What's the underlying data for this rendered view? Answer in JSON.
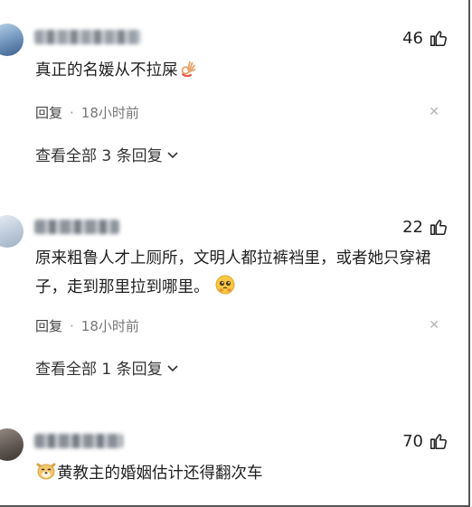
{
  "comments": [
    {
      "likes": "46",
      "text": "真正的名媛从不拉屎",
      "emoji_icon": "ok-hand-emoji-icon",
      "reply_label": "回复",
      "separator": "·",
      "time": "18小时前",
      "view_replies": "查看全部 3 条回复"
    },
    {
      "likes": "22",
      "text": "原来粗鲁人才上厕所，文明人都拉裤裆里，或者她只穿裙子，走到那里拉到哪里。",
      "emoji_icon": "pleading-face-emoji-icon",
      "reply_label": "回复",
      "separator": "·",
      "time": "18小时前",
      "view_replies": "查看全部 1 条回复"
    },
    {
      "likes": "70",
      "text": "黄教主的婚姻估计还得翻次车",
      "emoji_icon": "dog-face-emoji-icon"
    }
  ],
  "colors": {
    "text": "#1f1f1f",
    "meta": "#777777",
    "close": "#b5b5b5"
  }
}
